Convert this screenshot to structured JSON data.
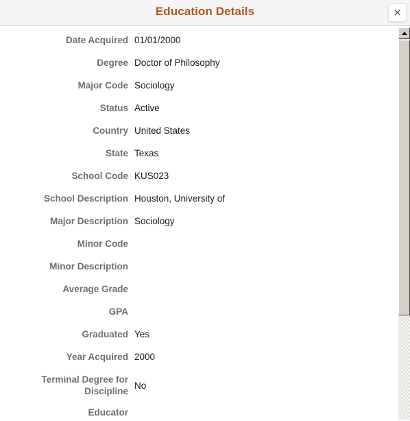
{
  "header": {
    "title": "Education Details",
    "close_label": "×"
  },
  "details": [
    {
      "label": "Date Acquired",
      "value": "01/01/2000"
    },
    {
      "label": "Degree",
      "value": "Doctor of Philosophy"
    },
    {
      "label": "Major Code",
      "value": "Sociology"
    },
    {
      "label": "Status",
      "value": "Active"
    },
    {
      "label": "Country",
      "value": "United States"
    },
    {
      "label": "State",
      "value": "Texas"
    },
    {
      "label": "School Code",
      "value": "KUS023"
    },
    {
      "label": "School Description",
      "value": "Houston, University of"
    },
    {
      "label": "Major Description",
      "value": "Sociology"
    },
    {
      "label": "Minor Code",
      "value": ""
    },
    {
      "label": "Minor Description",
      "value": ""
    },
    {
      "label": "Average Grade",
      "value": ""
    },
    {
      "label": "GPA",
      "value": ""
    },
    {
      "label": "Graduated",
      "value": "Yes"
    },
    {
      "label": "Year Acquired",
      "value": "2000"
    },
    {
      "label": "Terminal Degree for Discipline",
      "value": "No",
      "two_line": true
    },
    {
      "label": "Educator",
      "value": ""
    }
  ],
  "scrollbar": {
    "up_arrow": "scroll-up-arrow"
  },
  "colors": {
    "title": "#b3531b",
    "label": "#6f6f6f",
    "value": "#1a1a1a",
    "header_bg": "#f5f5f5"
  }
}
